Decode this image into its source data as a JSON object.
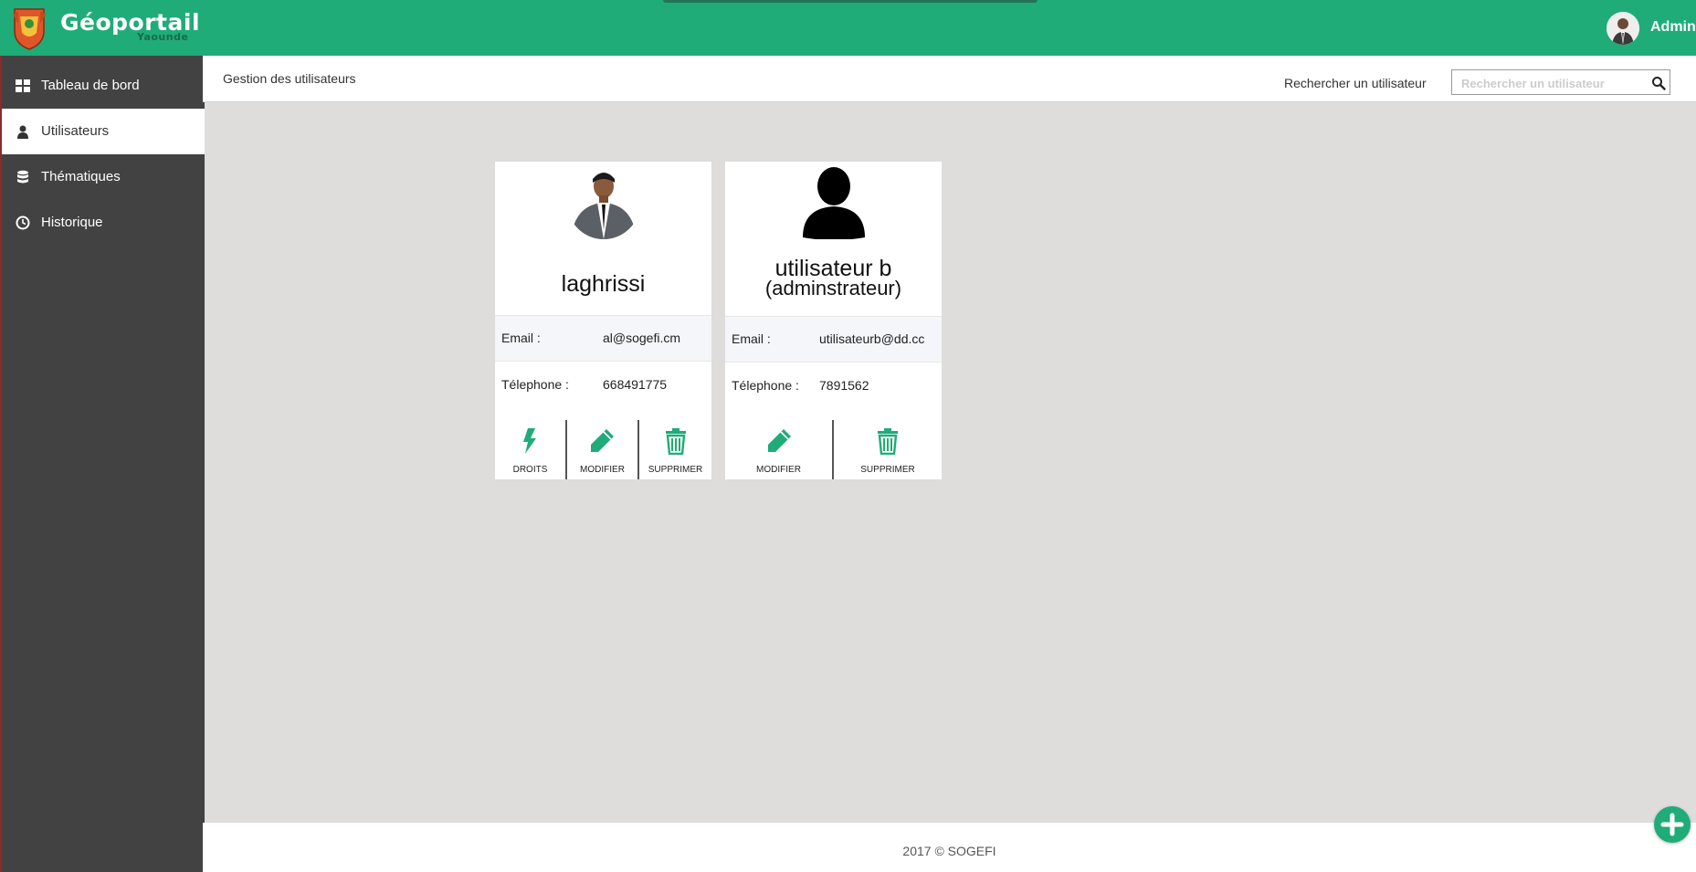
{
  "brand": {
    "title": "Géoportail",
    "subtitle": "Yaounde",
    "accent": "#1fac78"
  },
  "user": {
    "name": "Admin"
  },
  "sidebar": {
    "items": [
      {
        "label": "Tableau de bord",
        "icon": "dashboard-icon",
        "active": false
      },
      {
        "label": "Utilisateurs",
        "icon": "user-icon",
        "active": true
      },
      {
        "label": "Thématiques",
        "icon": "database-icon",
        "active": false
      },
      {
        "label": "Historique",
        "icon": "clock-icon",
        "active": false
      }
    ]
  },
  "header": {
    "title": "Gestion des utilisateurs",
    "search_label": "Rechercher un utilisateur",
    "search_placeholder": "Rechercher un utilisateur",
    "search_value": ""
  },
  "cards": [
    {
      "name": "laghrissi",
      "role": "",
      "email_label": "Email :",
      "email": "al@sogefi.cm",
      "phone_label": "Télephone :",
      "phone": "668491775",
      "photo": "person-photo",
      "actions": [
        "DROITS",
        "MODIFIER",
        "SUPPRIMER"
      ]
    },
    {
      "name": "utilisateur b",
      "role": "(adminstrateur)",
      "email_label": "Email :",
      "email": "utilisateurb@dd.cc",
      "phone_label": "Télephone :",
      "phone": "7891562",
      "photo": "user-silhouette-icon",
      "actions": [
        "MODIFIER",
        "SUPPRIMER"
      ]
    }
  ],
  "footer": {
    "text": "2017 © SOGEFI"
  },
  "fab": {
    "icon": "plus-icon"
  }
}
